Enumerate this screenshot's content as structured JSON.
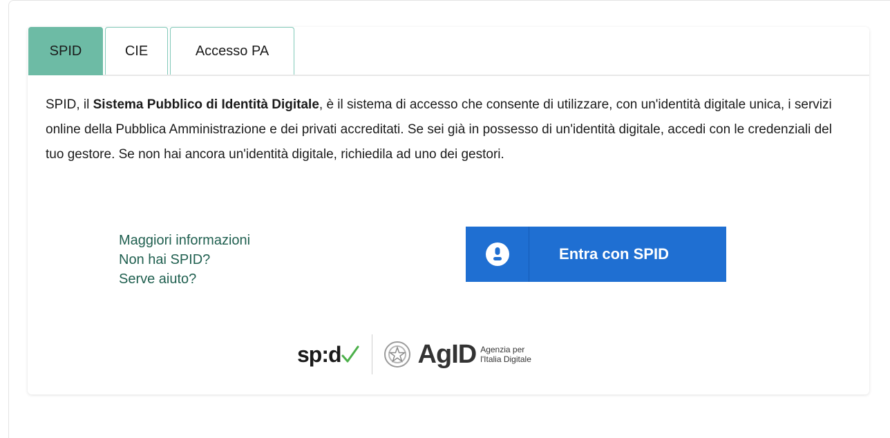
{
  "tabs": [
    {
      "label": "SPID",
      "active": true
    },
    {
      "label": "CIE",
      "active": false
    },
    {
      "label": "Accesso PA",
      "active": false
    }
  ],
  "description": {
    "prefix": "SPID, il ",
    "bold": "Sistema Pubblico di Identità Digitale",
    "suffix": ", è il sistema di accesso che consente di utilizzare, con un'identità digitale unica, i servizi online della Pubblica Amministrazione e dei privati accreditati. Se sei già in possesso di un'identità digitale, accedi con le credenziali del tuo gestore. Se non hai ancora un'identità digitale, richiedila ad uno dei gestori."
  },
  "links": {
    "more_info": "Maggiori informazioni",
    "no_spid": "Non hai SPID?",
    "help": "Serve aiuto?"
  },
  "spid_button": {
    "label": "Entra con SPID",
    "icon": "user-icon"
  },
  "footer_logos": {
    "spid": "sp:d",
    "agid": "AgID",
    "agid_sub_line1": "Agenzia per",
    "agid_sub_line2": "l'Italia Digitale"
  },
  "colors": {
    "tab_active": "#6dbba5",
    "tab_border": "#7fc8b7",
    "link": "#1f5f4f",
    "spid_button": "#1f6fd2",
    "spid_check": "#4cb04a"
  }
}
